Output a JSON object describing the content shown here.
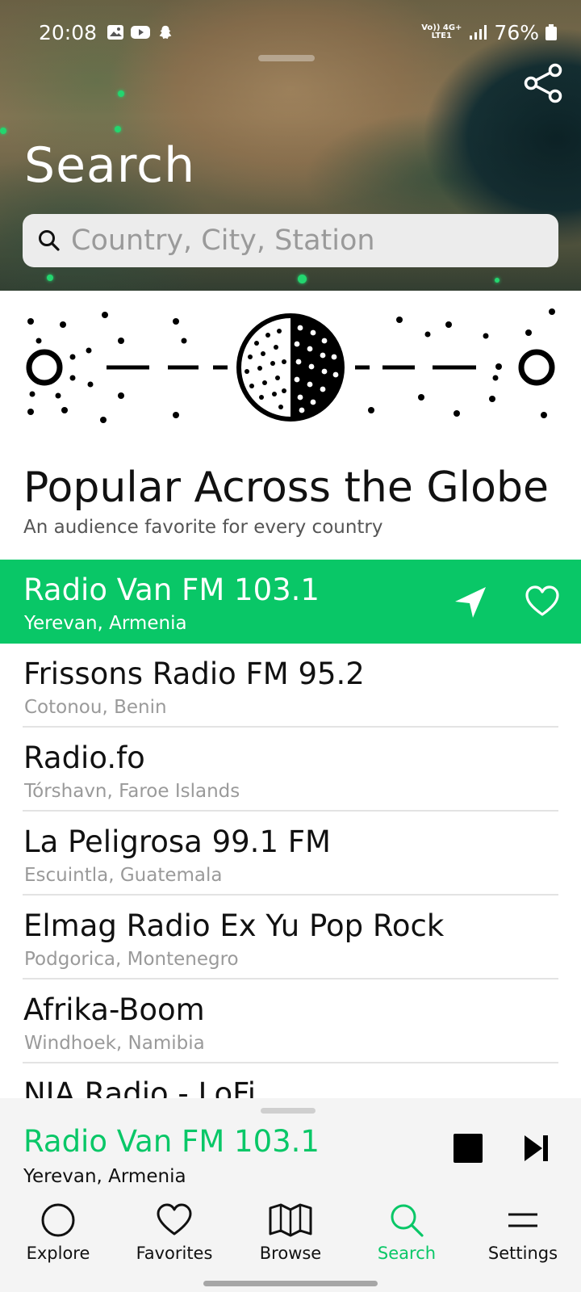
{
  "status_bar": {
    "time": "20:08",
    "network_top": "Vo)) 4G+",
    "network_bottom": "LTE1",
    "battery": "76%"
  },
  "header": {
    "title": "Search",
    "search_placeholder": "Country, City, Station"
  },
  "section": {
    "title": "Popular Across the Globe",
    "subtitle": "An audience favorite for every country"
  },
  "stations": [
    {
      "name": "Radio Van FM 103.1",
      "location": "Yerevan, Armenia"
    },
    {
      "name": "Frissons Radio FM 95.2",
      "location": "Cotonou, Benin"
    },
    {
      "name": "Radio.fo",
      "location": "Tórshavn, Faroe Islands"
    },
    {
      "name": "La Peligrosa 99.1 FM",
      "location": "Escuintla, Guatemala"
    },
    {
      "name": "Elmag Radio Ex Yu Pop Rock",
      "location": "Podgorica, Montenegro"
    },
    {
      "name": "Afrika-Boom",
      "location": "Windhoek, Namibia"
    },
    {
      "name": "NIA Radio - LoFi",
      "location": ""
    }
  ],
  "now_playing": {
    "title": "Radio Van FM 103.1",
    "location": "Yerevan, Armenia"
  },
  "nav": {
    "explore": "Explore",
    "favorites": "Favorites",
    "browse": "Browse",
    "search": "Search",
    "settings": "Settings"
  },
  "colors": {
    "accent": "#09c767",
    "active_row": "#09c767",
    "player_bg": "#f4f4f4"
  },
  "icons": [
    "share-icon",
    "search-icon",
    "locate-arrow-icon",
    "heart-icon",
    "stop-icon",
    "skip-next-icon",
    "explore-circle-icon",
    "favorites-heart-icon",
    "browse-map-icon",
    "search-tab-icon",
    "settings-lines-icon"
  ]
}
